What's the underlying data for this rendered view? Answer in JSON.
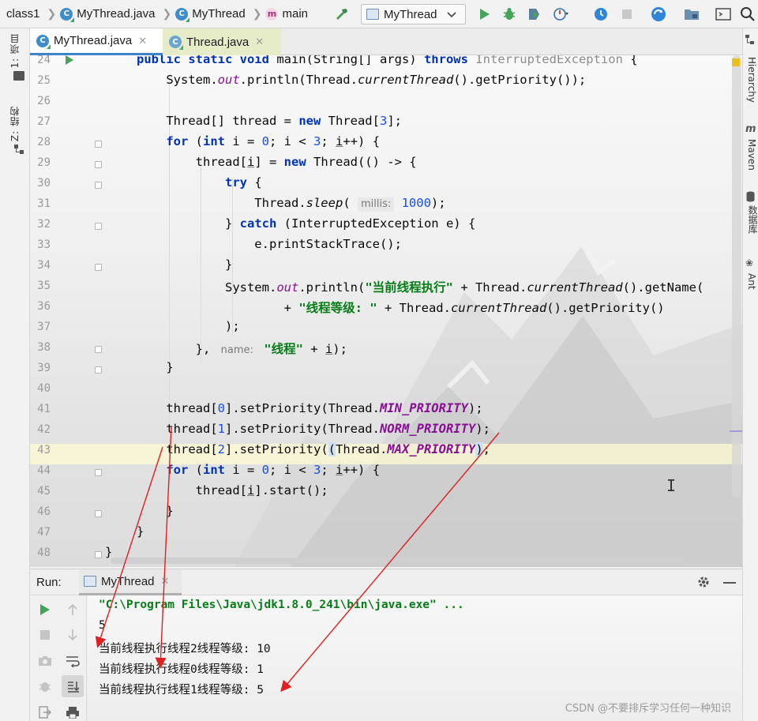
{
  "toolbar": {
    "breadcrumb": [
      "class1",
      "MyThread.java",
      "MyThread",
      "main"
    ],
    "run_config": "MyThread"
  },
  "left_strip": {
    "project_tab": "1: 项目",
    "structure_tab": "Z: 结构"
  },
  "right_strip": {
    "hierarchy_tab": "Hierarchy",
    "maven_tab": "Maven",
    "database_tab": "数据库",
    "ant_tab": "Ant"
  },
  "tabs": [
    {
      "label": "MyThread.java",
      "active": true
    },
    {
      "label": "Thread.java",
      "active": false
    }
  ],
  "editor": {
    "line_numbers": [
      "24",
      "25",
      "26",
      "27",
      "28",
      "29",
      "30",
      "31",
      "32",
      "33",
      "34",
      "35",
      "36",
      "37",
      "38",
      "39",
      "40",
      "41",
      "42",
      "43",
      "44",
      "45",
      "46",
      "47",
      "48"
    ],
    "hints": {
      "millis": "millis:",
      "name": "name:"
    },
    "strings": {
      "exec": "\"当前线程执行\"",
      "level": "\"线程等级: \"",
      "thread": "\"线程\""
    }
  },
  "run_panel": {
    "label": "Run:",
    "tab": "MyThread",
    "console": [
      "\"C:\\Program Files\\Java\\jdk1.8.0_241\\bin\\java.exe\" ...",
      "5",
      "当前线程执行线程2线程等级: 10",
      "当前线程执行线程0线程等级: 1",
      "当前线程执行线程1线程等级: 5"
    ]
  },
  "watermark": "CSDN @不要排斥学习任何一种知识",
  "colors": {
    "keyword": "#0033b3",
    "number": "#1750eb",
    "string": "#067d17",
    "field": "#871094",
    "annotation_arrow": "#e02020"
  }
}
